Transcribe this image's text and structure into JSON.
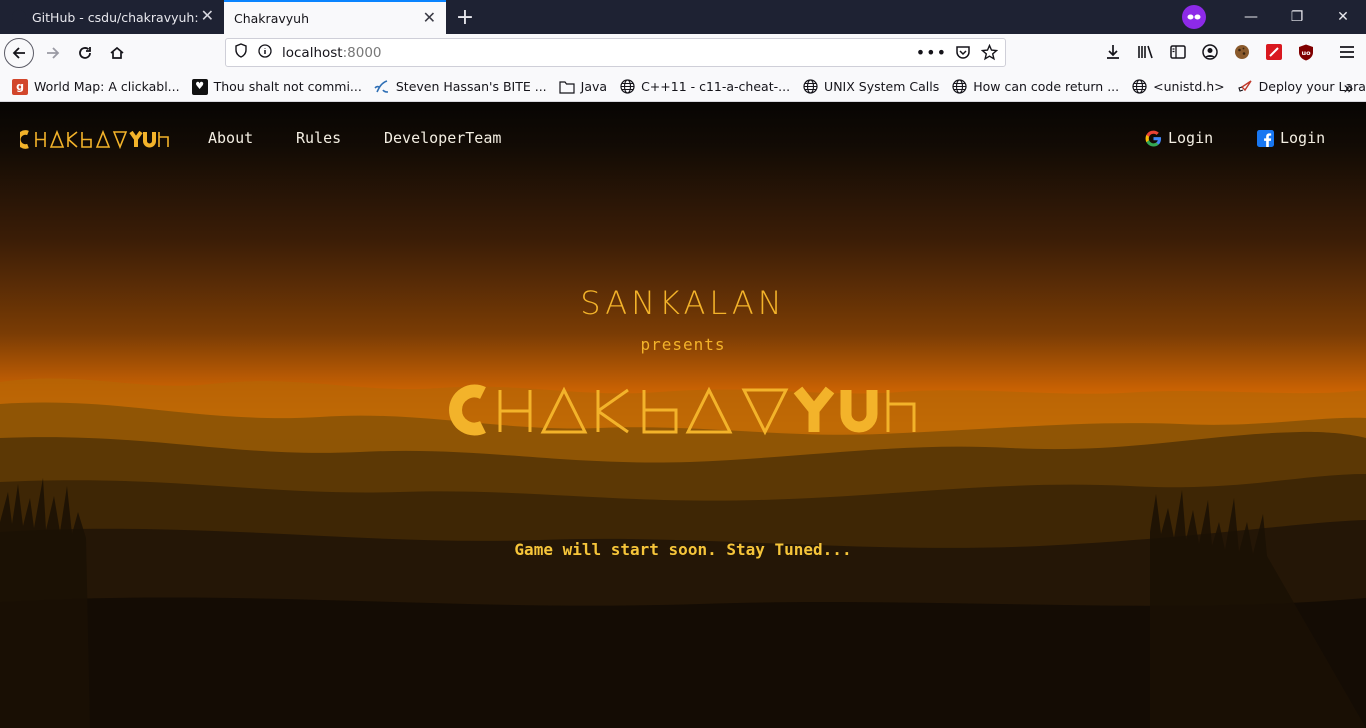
{
  "browser": {
    "tabs": [
      {
        "title": "GitHub - csdu/chakravyuh: Chakravyuh",
        "active": false
      },
      {
        "title": "Chakravyuh",
        "active": true
      }
    ],
    "new_tab_symbol": "+",
    "url": {
      "host": "localhost",
      "port": ":8000"
    },
    "window_controls": {
      "minimize": "—",
      "restore": "❐",
      "close": "✕"
    },
    "bookmarks": [
      {
        "label": "World Map: A clickabl...",
        "icon": "g-red-icon"
      },
      {
        "label": "Thou shalt not commi...",
        "icon": "heart-icon"
      },
      {
        "label": "Steven Hassan's BITE ...",
        "icon": "splash-icon"
      },
      {
        "label": "Java",
        "icon": "folder-icon"
      },
      {
        "label": "C++11 - c11-a-cheat-...",
        "icon": "globe-icon"
      },
      {
        "label": "UNIX System Calls",
        "icon": "globe-icon"
      },
      {
        "label": "How can code return ...",
        "icon": "globe-icon"
      },
      {
        "label": "<unistd.h>",
        "icon": "globe-icon"
      },
      {
        "label": "Deploy your Laravel Pr...",
        "icon": "rocket-icon"
      }
    ],
    "colors": {
      "tab_bar": "#1e2233",
      "active_tab_accent": "#0a84ff",
      "toolbar": "#f9f9fb",
      "private": "#8d2ae8"
    }
  },
  "site": {
    "brand": "CHAKRAVYUH",
    "nav": [
      {
        "label": "About"
      },
      {
        "label": "Rules"
      },
      {
        "label": "DeveloperTeam"
      }
    ],
    "logins": [
      {
        "label": "Login",
        "icon": "google-icon"
      },
      {
        "label": "Login",
        "icon": "facebook-icon"
      }
    ],
    "hero": {
      "organizer": "SANKALAN",
      "presents": "presents",
      "title": "CHAKRAVYUH"
    },
    "status": "Game will start soon. Stay Tuned...",
    "colors": {
      "accent": "#f3b32a",
      "status": "#f6c53a",
      "nav_text": "#f3eee2",
      "google_red": "#ea4335",
      "facebook_blue": "#1877f2"
    }
  }
}
